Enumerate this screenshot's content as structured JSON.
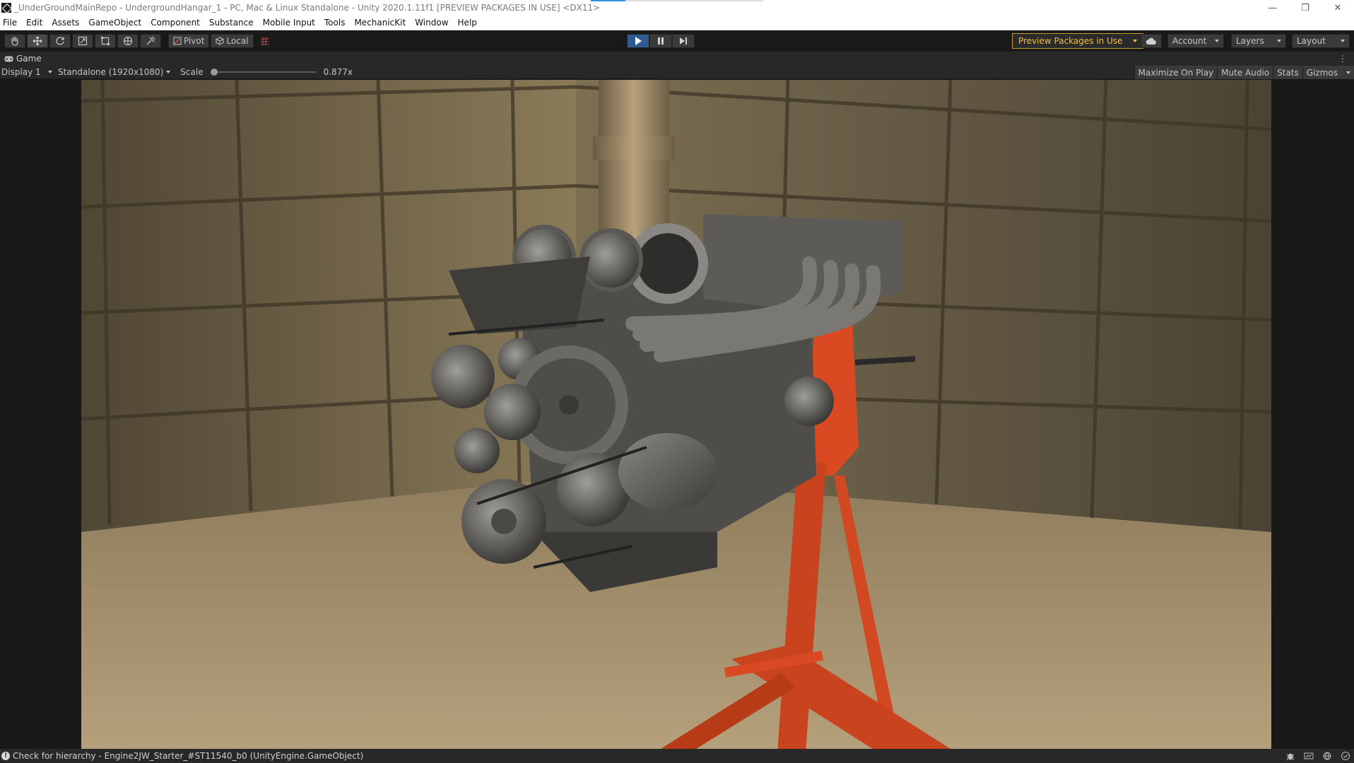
{
  "window": {
    "title": "_UnderGroundMainRepo - UndergroundHangar_1 - PC, Mac & Linux Standalone - Unity 2020.1.11f1 [PREVIEW PACKAGES IN USE] <DX11>",
    "minimize_glyph": "—",
    "restore_glyph": "❐",
    "close_glyph": "✕"
  },
  "menu": [
    "File",
    "Edit",
    "Assets",
    "GameObject",
    "Component",
    "Substance",
    "Mobile Input",
    "Tools",
    "MechanicKit",
    "Window",
    "Help"
  ],
  "toolbar": {
    "tools": [
      "hand-tool-icon",
      "move-tool-icon",
      "rotate-tool-icon",
      "scale-tool-icon",
      "rect-tool-icon",
      "transform-tool-icon",
      "custom-tool-icon"
    ],
    "active_tool": "move-tool-icon",
    "pivot_label": "Pivot",
    "local_label": "Local",
    "play_state": "playing",
    "preview_packages_label": "Preview Packages in Use",
    "account_label": "Account",
    "layers_label": "Layers",
    "layout_label": "Layout",
    "accent_color": "#3a8ee6",
    "warning_color": "#f0c040"
  },
  "game_view": {
    "tab_label": "Game",
    "display_label": "Display 1",
    "resolution_label": "Standalone (1920x1080)",
    "scale_label": "Scale",
    "scale_value": "0.877",
    "scale_value_label": "0.877x",
    "toggles": [
      "Maximize On Play",
      "Mute Audio",
      "Stats",
      "Gizmos"
    ]
  },
  "scene": {
    "wall_color": "#6e6248",
    "floor_color": "#a08a66",
    "engine_color": "#5a5a58",
    "stand_color": "#d94a22"
  },
  "status": {
    "message": "Check for hierarchy - Engine2JW_Starter_#ST11540_b0 (UnityEngine.GameObject)"
  }
}
